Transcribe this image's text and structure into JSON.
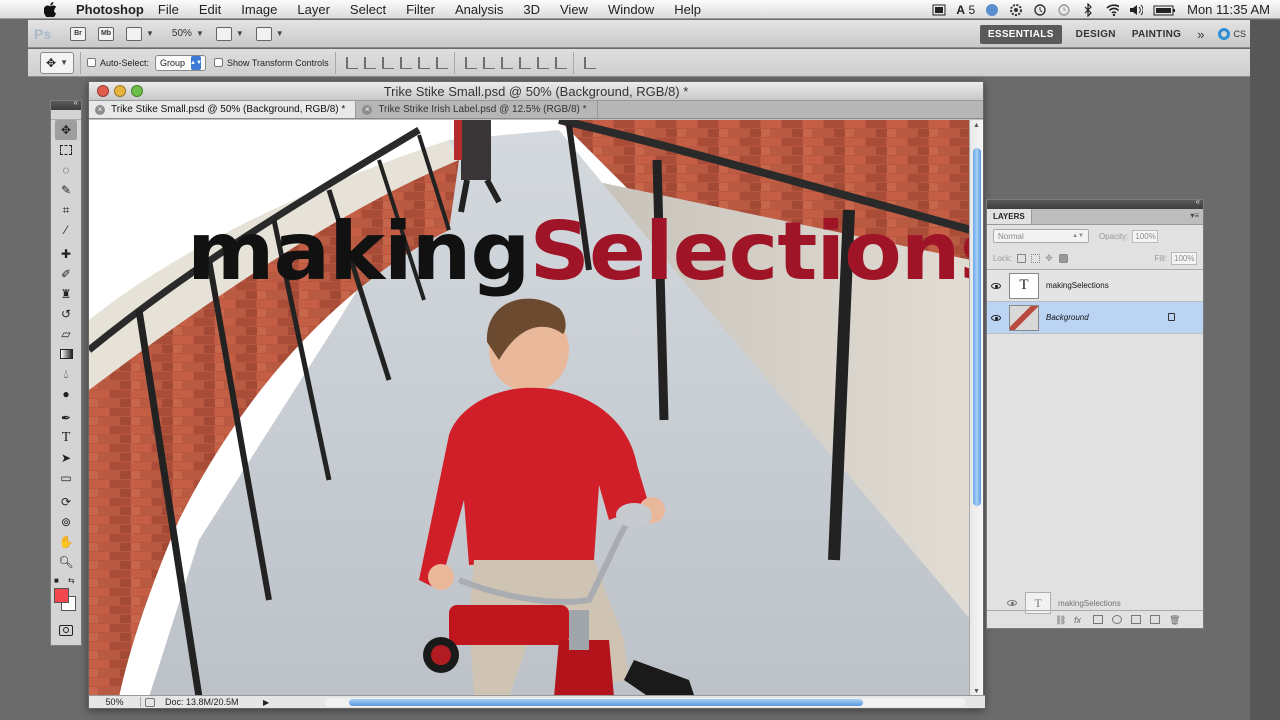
{
  "menubar": {
    "app_name": "Photoshop",
    "menus": [
      "File",
      "Edit",
      "Image",
      "Layer",
      "Select",
      "Filter",
      "Analysis",
      "3D",
      "View",
      "Window",
      "Help"
    ],
    "clock": "Mon 11:35 AM",
    "status_number": "5"
  },
  "appbar": {
    "logo": "Ps",
    "bridge": "Br",
    "minibridge": "Mb",
    "zoom": "50%",
    "workspaces": [
      "ESSENTIALS",
      "DESIGN",
      "PAINTING"
    ],
    "more": "»",
    "cslive": "CS"
  },
  "options": {
    "auto_select_label": "Auto-Select:",
    "auto_select_value": "Group",
    "transform_label": "Show Transform Controls"
  },
  "document": {
    "title": "Trike Stike Small.psd @ 50% (Background, RGB/8) *",
    "tabs": [
      {
        "label": "Trike Stike Small.psd @ 50% (Background, RGB/8) *",
        "active": true
      },
      {
        "label": "Trike Strike Irish Label.psd @ 12.5% (RGB/8) *",
        "active": false
      }
    ],
    "overlay_word1": "making",
    "overlay_word2": "Selections",
    "zoom_status": "50%",
    "doc_size": "Doc: 13.8M/20.5M"
  },
  "colors": {
    "foreground": "#f2474e",
    "background": "#ffffff",
    "text_dark": "#111111",
    "text_red": "#a01428"
  },
  "layers_panel": {
    "tab": "LAYERS",
    "blend_mode": "Normal",
    "opacity_label": "Opacity:",
    "opacity_value": "100%",
    "lock_label": "Lock:",
    "fill_label": "Fill:",
    "fill_value": "100%",
    "layers": [
      {
        "name": "makingSelections",
        "thumb": "T",
        "selected": false
      },
      {
        "name": "Background",
        "thumb": "",
        "selected": true
      }
    ],
    "ghost_layer": "makingSelections"
  }
}
